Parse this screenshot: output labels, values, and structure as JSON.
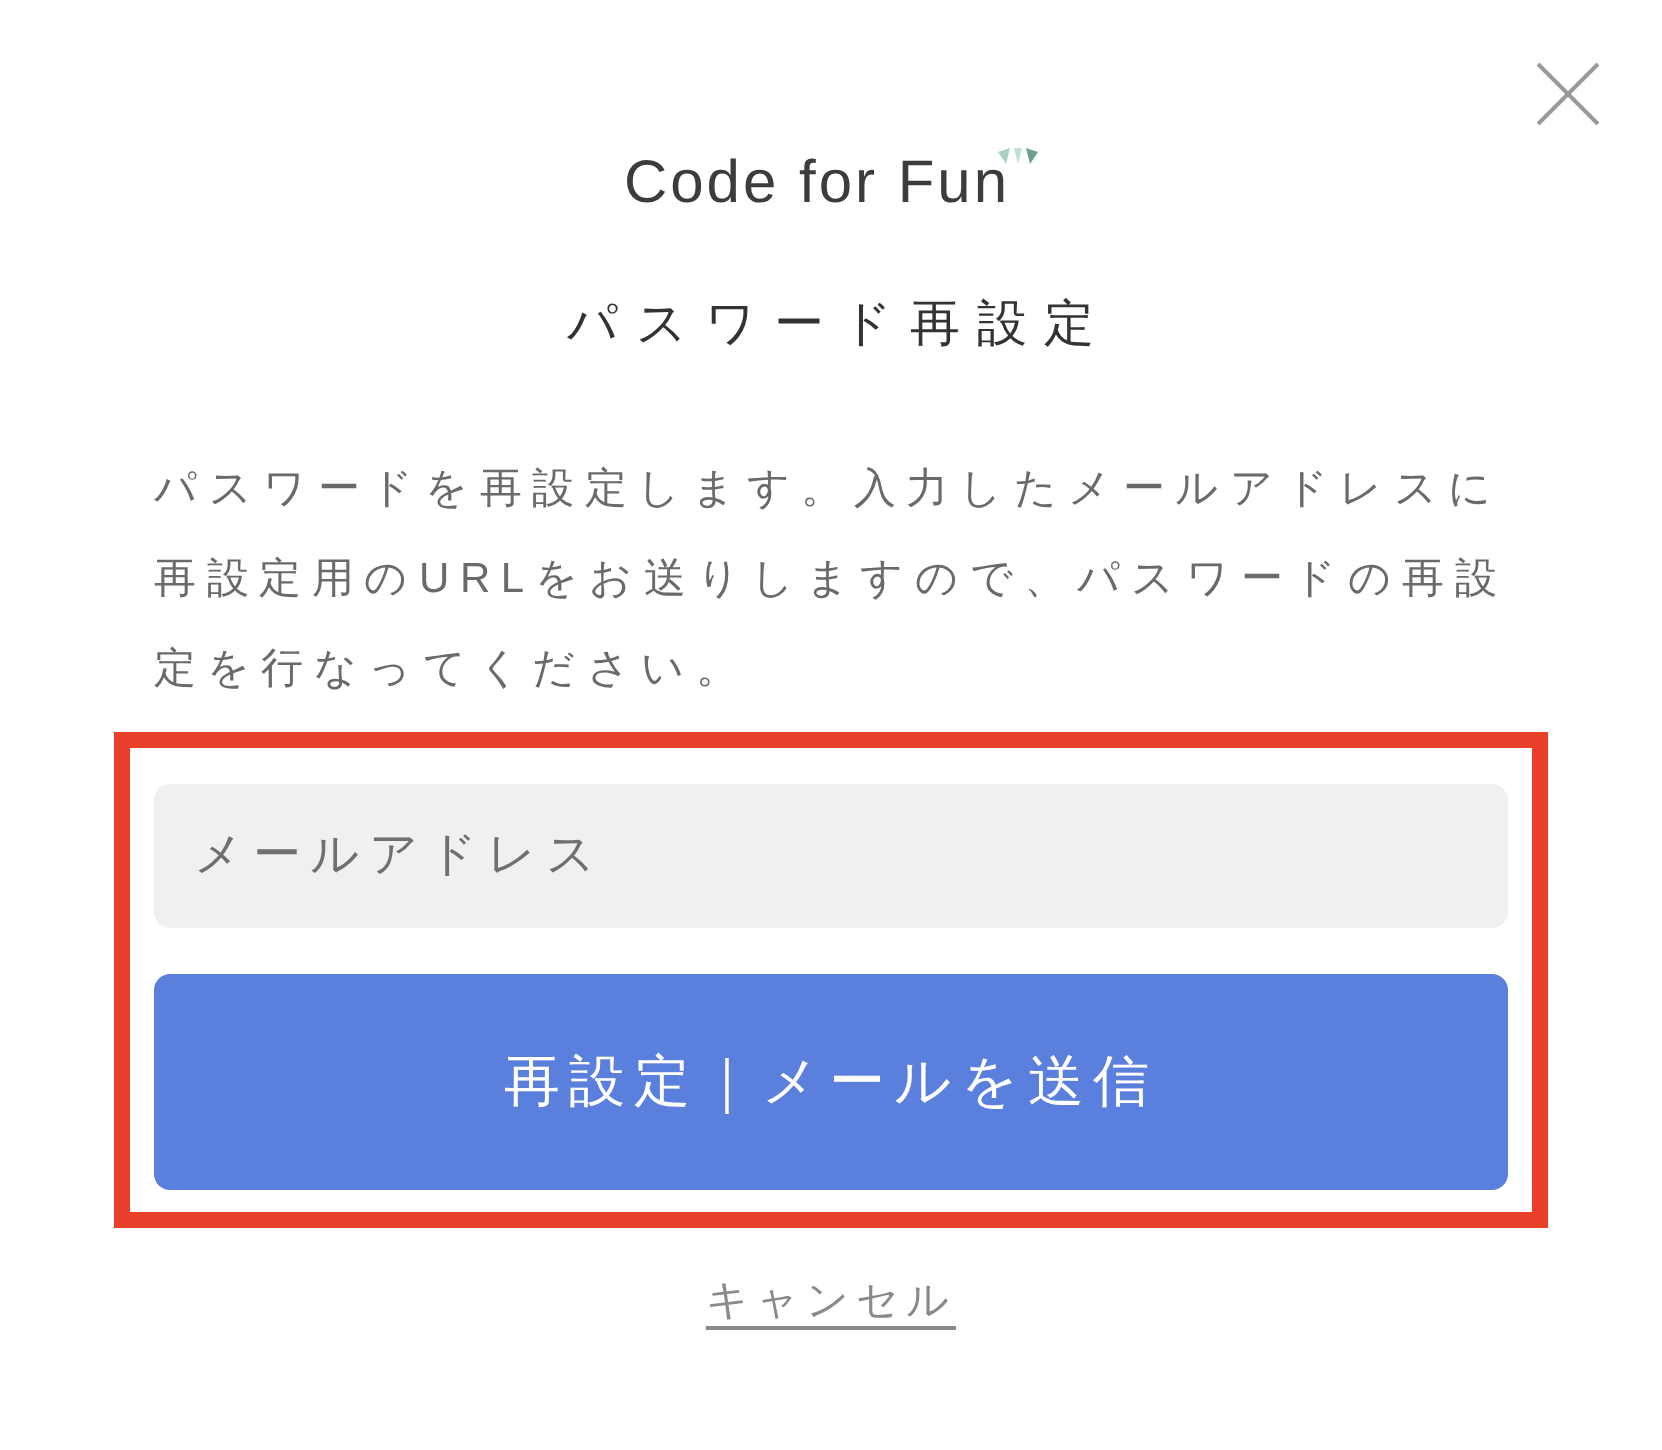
{
  "logo": {
    "text": "Code for Fun"
  },
  "title": "パスワード再設定",
  "description": "パスワードを再設定します。入力したメールアドレスに再設定用のURLをお送りしますので、パスワードの再設定を行なってください。",
  "form": {
    "highlighted": true,
    "email_field": {
      "placeholder": "メールアドレス"
    },
    "submit_button": {
      "label": "再設定｜メールを送信"
    }
  },
  "cancel_link": {
    "label": "キャンセル"
  }
}
